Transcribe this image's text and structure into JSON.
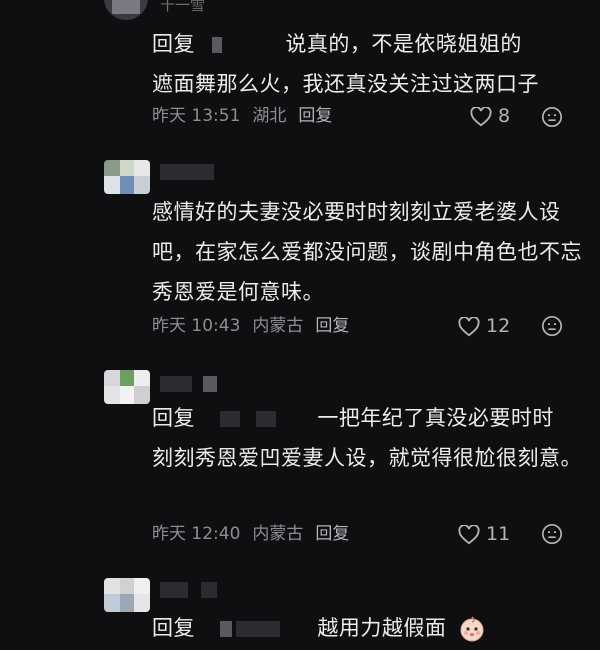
{
  "comments": [
    {
      "username_fragment": "十一雪",
      "reply_prefix": "回复",
      "text_line1": "说真的，不是依晓姐姐的",
      "text_line2": "遮面舞那么火，我还真没关注过这两口子",
      "time": "昨天 13:51",
      "location": "湖北",
      "reply_label": "回复",
      "likes": "8"
    },
    {
      "text": "感情好的夫妻没必要时时刻刻立爱老婆人设吧，在家怎么爱都没问题，谈剧中角色也不忘秀恩爱是何意味。",
      "time": "昨天 10:43",
      "location": "内蒙古",
      "reply_label": "回复",
      "likes": "12"
    },
    {
      "reply_prefix": "回复",
      "text_line1": "一把年纪了真没必要时时",
      "text_rest": "刻刻秀恩爱凹爱妻人设，就觉得很尬很刻意。",
      "time": "昨天 12:40",
      "location": "内蒙古",
      "reply_label": "回复",
      "likes": "11"
    },
    {
      "reply_prefix": "回复",
      "text": "越用力越假面"
    }
  ],
  "icons": {
    "like": "heart-outline-icon",
    "dislike": "unhappy-face-icon",
    "emoji": "baby-face-emoji-icon"
  }
}
